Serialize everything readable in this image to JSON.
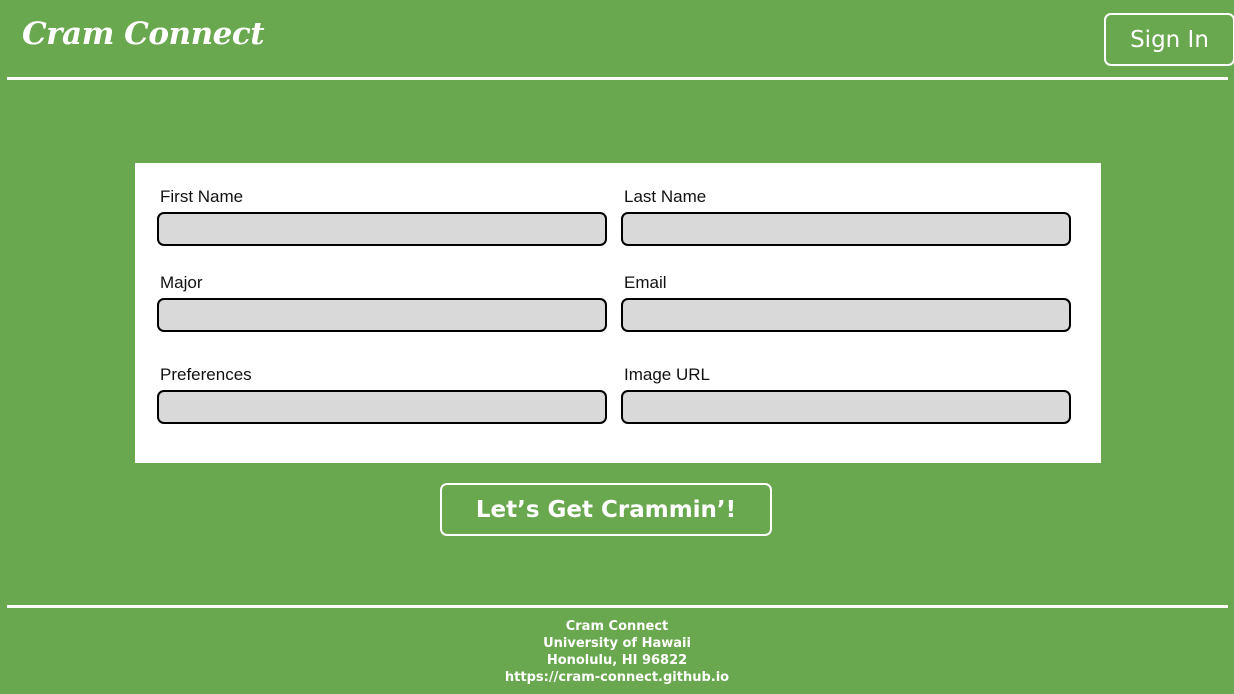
{
  "header": {
    "brand": "Cram Connect",
    "sign_in_label": "Sign In"
  },
  "form": {
    "fields": [
      {
        "label": "First Name",
        "value": "",
        "placeholder": ""
      },
      {
        "label": "Last Name",
        "value": "",
        "placeholder": ""
      },
      {
        "label": "Major",
        "value": "",
        "placeholder": ""
      },
      {
        "label": "Email",
        "value": "",
        "placeholder": ""
      },
      {
        "label": "Preferences",
        "value": "",
        "placeholder": ""
      },
      {
        "label": "Image URL",
        "value": "",
        "placeholder": ""
      }
    ],
    "submit_label": "Let’s Get Crammin’!"
  },
  "footer": {
    "name": "Cram Connect",
    "university": "University of Hawaii",
    "city": "Honolulu, HI 96822",
    "url": "https://cram-connect.github.io"
  },
  "colors": {
    "background": "#6aa84f",
    "card": "#ffffff",
    "input_fill": "#d9d9d9",
    "text_light": "#ffffff",
    "text_dark": "#111111"
  }
}
